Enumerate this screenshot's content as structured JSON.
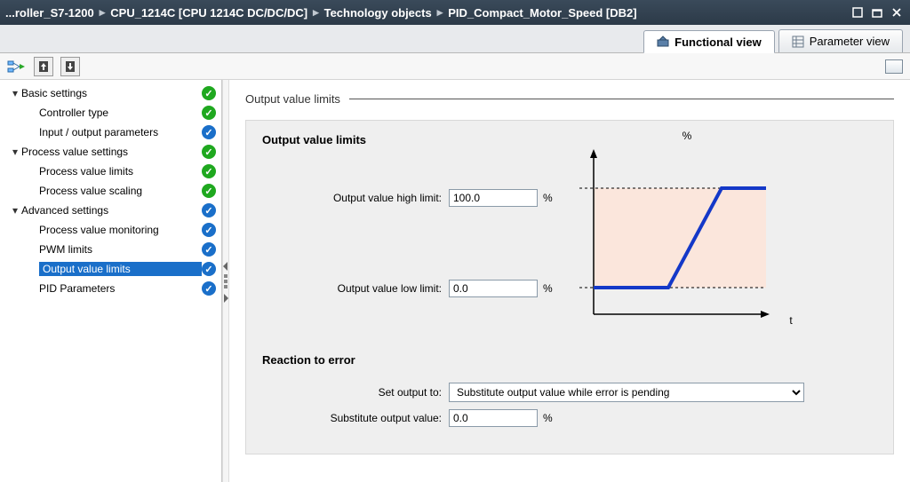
{
  "titlebar": {
    "crumbs": [
      "...roller_S7-1200",
      "CPU_1214C [CPU 1214C DC/DC/DC]",
      "Technology objects",
      "PID_Compact_Motor_Speed [DB2]"
    ]
  },
  "tabs": {
    "functional": "Functional view",
    "parameter": "Parameter view"
  },
  "nav": {
    "items": [
      {
        "label": "Basic settings",
        "level": 1,
        "expand": true,
        "status": "green"
      },
      {
        "label": "Controller type",
        "level": 2,
        "status": "green"
      },
      {
        "label": "Input / output parameters",
        "level": 2,
        "status": "blue"
      },
      {
        "label": "Process value settings",
        "level": 1,
        "expand": true,
        "status": "green"
      },
      {
        "label": "Process value limits",
        "level": 2,
        "status": "green"
      },
      {
        "label": "Process value scaling",
        "level": 2,
        "status": "green"
      },
      {
        "label": "Advanced settings",
        "level": 1,
        "expand": true,
        "status": "blue"
      },
      {
        "label": "Process value monitoring",
        "level": 2,
        "status": "blue"
      },
      {
        "label": "PWM limits",
        "level": 2,
        "status": "blue"
      },
      {
        "label": "Output value limits",
        "level": 2,
        "status": "blue",
        "selected": true
      },
      {
        "label": "PID Parameters",
        "level": 2,
        "status": "blue"
      }
    ]
  },
  "content": {
    "section_title": "Output value limits",
    "box_title": "Output value limits",
    "high_limit_label": "Output value high limit:",
    "high_limit_value": "100.0",
    "high_limit_unit": "%",
    "low_limit_label": "Output value low limit:",
    "low_limit_value": "0.0",
    "low_limit_unit": "%",
    "graph_y": "%",
    "graph_x": "t",
    "reaction_title": "Reaction to error",
    "set_output_label": "Set output to:",
    "set_output_value": "Substitute output value while error is pending",
    "sub_value_label": "Substitute output value:",
    "sub_value_value": "0.0",
    "sub_value_unit": "%"
  }
}
